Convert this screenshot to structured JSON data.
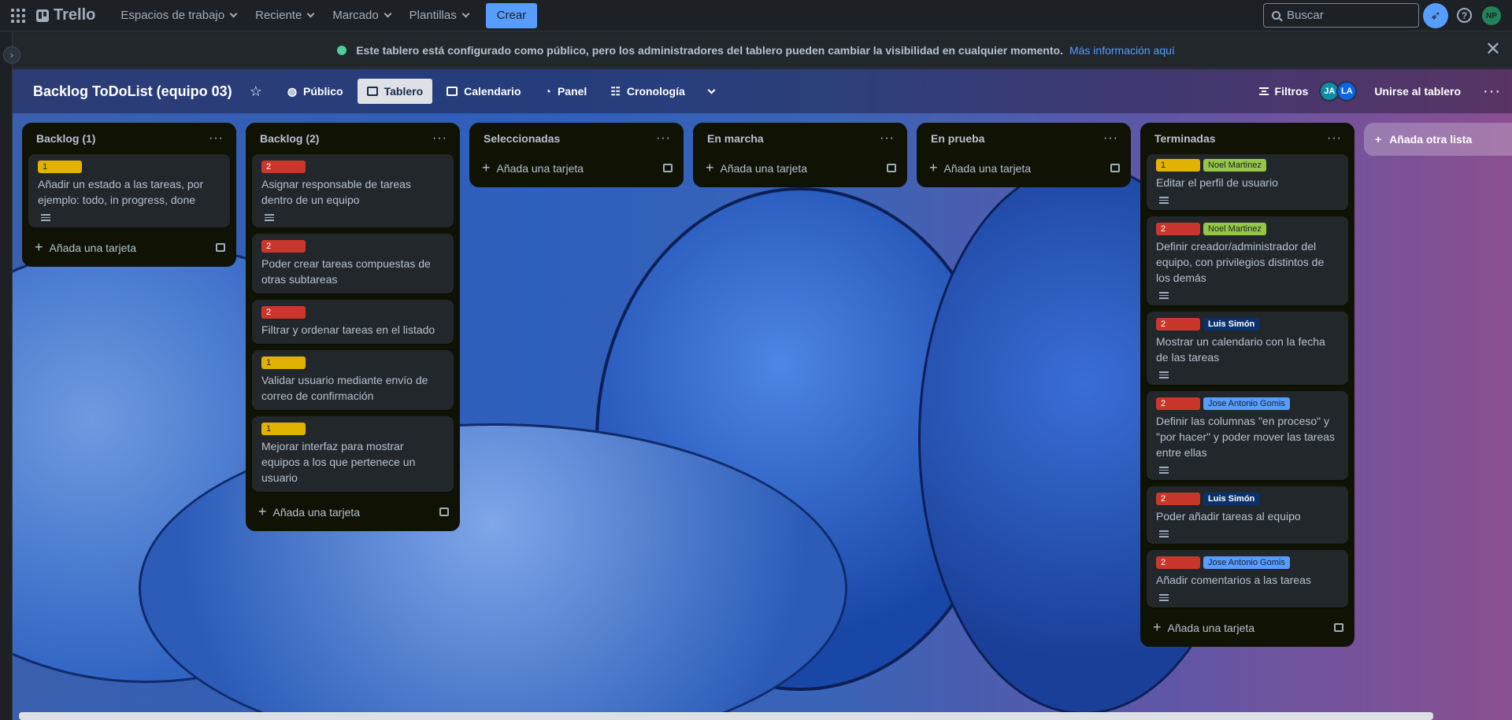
{
  "topnav": {
    "logo_text": "Trello",
    "menus": [
      "Espacios de trabajo",
      "Reciente",
      "Marcado",
      "Plantillas"
    ],
    "create_label": "Crear",
    "search_placeholder": "Buscar",
    "help_glyph": "?",
    "user_initials": "NP"
  },
  "banner": {
    "text": "Este tablero está configurado como público, pero los administradores del tablero pueden cambiar la visibilidad en cualquier momento.",
    "link": "Más información aquí",
    "close_glyph": "✕"
  },
  "board": {
    "title": "Backlog ToDoList (equipo 03)",
    "visibility": "Público",
    "views": [
      "Tablero",
      "Calendario",
      "Panel",
      "Cronología"
    ],
    "filters_label": "Filtros",
    "members": [
      "JA",
      "LA"
    ],
    "join_label": "Unirse al tablero",
    "add_list_label": "Añada otra lista"
  },
  "lists": [
    {
      "title": "Backlog (1)",
      "add_card": "Añada una tarjeta",
      "cards": [
        {
          "priority": "1",
          "text": "Añadir un estado a las tareas, por ejemplo: todo, in progress, done",
          "has_desc": true
        }
      ]
    },
    {
      "title": "Backlog (2)",
      "add_card": "Añada una tarjeta",
      "cards": [
        {
          "priority": "2",
          "text": "Asignar responsable de tareas dentro de un equipo",
          "has_desc": true
        },
        {
          "priority": "2",
          "text": "Poder crear tareas compuestas de otras subtareas"
        },
        {
          "priority": "2",
          "text": "Filtrar y ordenar tareas en el listado"
        },
        {
          "priority": "1",
          "text": "Validar usuario mediante envío de correo de confirmación"
        },
        {
          "priority": "1",
          "text": "Mejorar interfaz para mostrar equipos a los que pertenece un usuario"
        }
      ]
    },
    {
      "title": "Seleccionadas",
      "add_card": "Añada una tarjeta",
      "cards": []
    },
    {
      "title": "En marcha",
      "add_card": "Añada una tarjeta",
      "cards": []
    },
    {
      "title": "En prueba",
      "add_card": "Añada una tarjeta",
      "cards": []
    },
    {
      "title": "Terminadas",
      "add_card": "Añada una tarjeta",
      "cards": [
        {
          "priority": "1",
          "member": "Noel Martinez",
          "member_color": "green",
          "text": "Editar el perfil de usuario",
          "has_desc": true
        },
        {
          "priority": "2",
          "member": "Noel Martinez",
          "member_color": "green",
          "text": "Definir creador/administrador del equipo, con privilegios distintos de los demás",
          "has_desc": true
        },
        {
          "priority": "2",
          "member": "Luis Simón",
          "member_color": "navy",
          "text": "Mostrar un calendario con la fecha de las tareas",
          "has_desc": true
        },
        {
          "priority": "2",
          "member": "Jose Antonio Gomis",
          "member_color": "blue",
          "text": "Definir las columnas \"en proceso\" y \"por hacer\" y poder mover las tareas entre ellas",
          "has_desc": true
        },
        {
          "priority": "2",
          "member": "Luis Simón",
          "member_color": "navy",
          "text": "Poder añadir tareas al equipo",
          "has_desc": true
        },
        {
          "priority": "2",
          "member": "Jose Antonio Gomis",
          "member_color": "blue",
          "text": "Añadir comentarios a las tareas",
          "has_desc": true
        }
      ]
    }
  ],
  "colors": {
    "accent": "#579dff",
    "label_1": "#e2b203",
    "label_2": "#c9372c",
    "list_bg": "#101204",
    "card_bg": "#22272b"
  }
}
